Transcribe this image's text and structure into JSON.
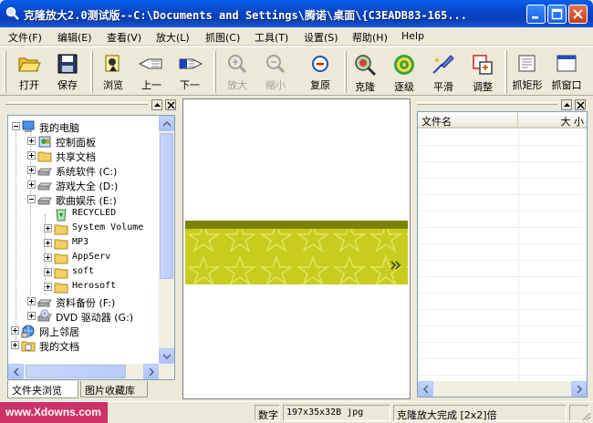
{
  "window": {
    "title": "克隆放大2.0测试版--C:\\Documents and Settings\\腾诺\\桌面\\{C3EADB83-165..."
  },
  "menu": [
    {
      "label": "文件(F)"
    },
    {
      "label": "编辑(E)"
    },
    {
      "label": "查看(V)"
    },
    {
      "label": "放大(L)"
    },
    {
      "label": "抓图(C)"
    },
    {
      "label": "工具(T)"
    },
    {
      "label": "设置(S)"
    },
    {
      "label": "帮助(H)"
    },
    {
      "label": "Help"
    }
  ],
  "toolbar": {
    "open": "打开",
    "save": "保存",
    "browse": "浏览",
    "prev": "上一",
    "next": "下一",
    "zoom_in": "放大",
    "zoom_out": "缩小",
    "restore": "复原",
    "clone": "克隆",
    "stepwise": "逐级",
    "smooth": "平滑",
    "adjust": "调整",
    "capture_rect": "抓矩形",
    "capture_window": "抓窗口"
  },
  "tree": {
    "items": [
      {
        "label": "我的电脑",
        "icon": "computer-icon"
      },
      {
        "label": "控制面板",
        "icon": "control-panel-icon"
      },
      {
        "label": "共享文档",
        "icon": "folder-icon"
      },
      {
        "label": "系统软件 (C:)",
        "icon": "drive-icon"
      },
      {
        "label": "游戏大全 (D:)",
        "icon": "drive-icon"
      },
      {
        "label": "歌曲娱乐 (E:)",
        "icon": "drive-icon"
      },
      {
        "label": "RECYCLED",
        "icon": "recycle-icon"
      },
      {
        "label": "System Volume",
        "icon": "folder-icon"
      },
      {
        "label": "MP3",
        "icon": "folder-icon"
      },
      {
        "label": "AppServ",
        "icon": "folder-icon"
      },
      {
        "label": "soft",
        "icon": "folder-icon"
      },
      {
        "label": "Herosoft",
        "icon": "folder-icon"
      },
      {
        "label": "资料备份 (F:)",
        "icon": "drive-icon"
      },
      {
        "label": "DVD 驱动器 (G:)",
        "icon": "dvd-icon"
      },
      {
        "label": "网上邻居",
        "icon": "network-icon"
      },
      {
        "label": "我的文档",
        "icon": "documents-icon"
      }
    ]
  },
  "tabs": [
    {
      "label": "文件夹浏览"
    },
    {
      "label": "图片收藏库"
    }
  ],
  "list": {
    "col_name": "文件名",
    "col_size": "大 小"
  },
  "status": {
    "mode": "数字",
    "image_info": "197x35x32B jpg",
    "message": "克隆放大完成 [2x2]倍"
  },
  "watermark": "www.Xdowns.com",
  "colors": {
    "strip_top": "#7c8200",
    "strip_fill": "#c8cc1e",
    "title_bar": "#0846c8",
    "watermark_bg": "#cd3266"
  }
}
